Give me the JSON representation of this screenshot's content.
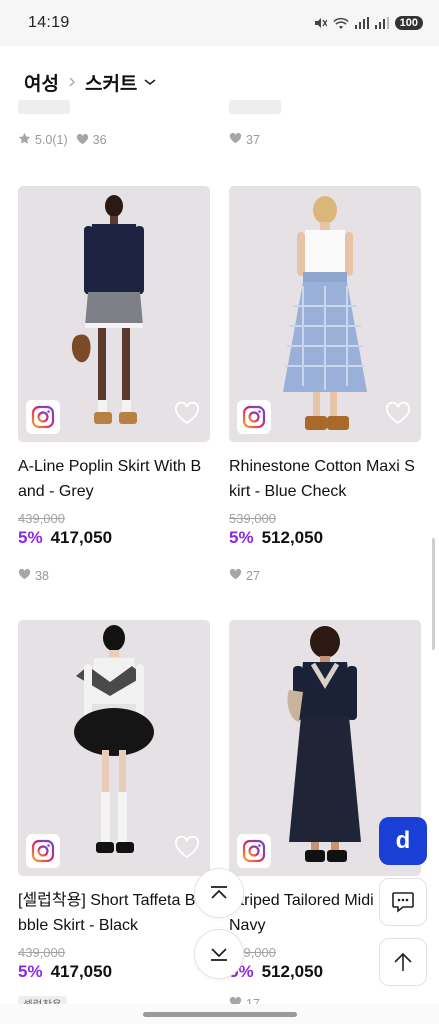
{
  "status_bar": {
    "time": "14:19",
    "battery": "100"
  },
  "header": {
    "category_root": "여성",
    "category_current": "스커트"
  },
  "top_row": {
    "left": {
      "rating": "5.0(1)",
      "likes": "36"
    },
    "right": {
      "likes": "37"
    }
  },
  "products": [
    {
      "name": "A-Line Poplin Skirt With Band - Grey",
      "original_price": "439,000",
      "discount": "5%",
      "price": "417,050",
      "likes": "38"
    },
    {
      "name": "Rhinestone Cotton Maxi Skirt - Blue Check",
      "original_price": "539,000",
      "discount": "5%",
      "price": "512,050",
      "likes": "27"
    },
    {
      "name": "[셀럽착용] Short Taffeta Bubble Skirt - Black",
      "original_price": "439,000",
      "discount": "5%",
      "price": "417,050",
      "badge": "셀럽착용"
    },
    {
      "name": "Striped Tailored Midi Skirt - Navy",
      "original_price": "539,000",
      "discount": "5%",
      "price": "512,050",
      "likes": "17"
    }
  ],
  "floating": {
    "brand_label": "d"
  },
  "colors": {
    "accent": "#8a2be2",
    "brand_button": "#1a3fd6",
    "photo_bg": "#e6e1e4"
  }
}
